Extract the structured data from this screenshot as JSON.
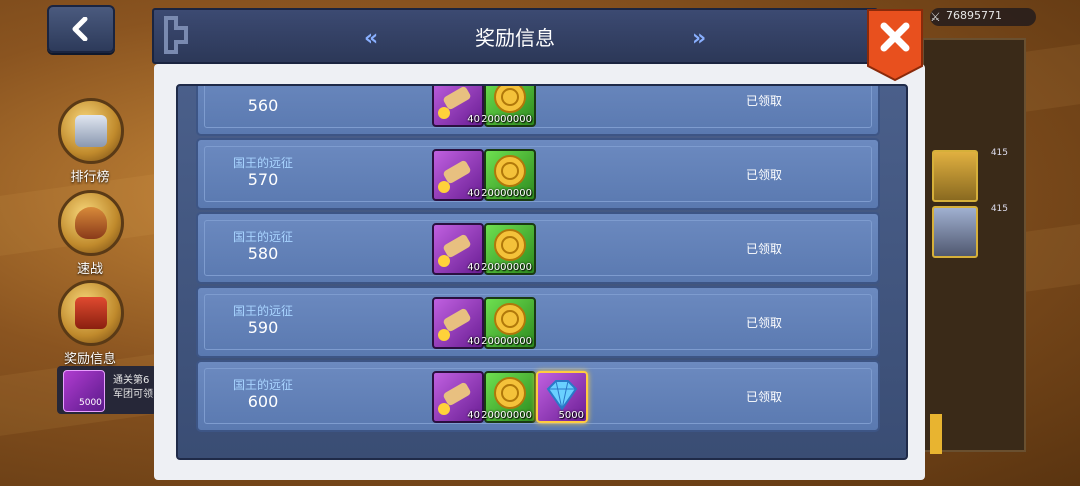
{
  "header": {
    "title": "奖励信息",
    "close_label": "✖"
  },
  "currency": {
    "value": "76895771"
  },
  "sidebar": {
    "items": [
      {
        "label": "排行榜",
        "icon": "trophy-icon"
      },
      {
        "label": "速战",
        "icon": "shield-icon"
      },
      {
        "label": "奖励信息",
        "icon": "chest-icon"
      }
    ],
    "notice": {
      "line1": "通关第6",
      "line2": "军团可领",
      "count": "5000"
    }
  },
  "right_heroes": [
    {
      "level": "415"
    },
    {
      "level": "415"
    }
  ],
  "rewards": [
    {
      "name": "",
      "level": "560",
      "status": "已领取",
      "items": [
        {
          "type": "scroll-fragment",
          "qty": "40"
        },
        {
          "type": "gold-coin",
          "qty": "20000000"
        }
      ]
    },
    {
      "name": "国王的远征",
      "level": "570",
      "status": "已领取",
      "items": [
        {
          "type": "scroll-fragment",
          "qty": "40"
        },
        {
          "type": "gold-coin",
          "qty": "20000000"
        }
      ]
    },
    {
      "name": "国王的远征",
      "level": "580",
      "status": "已领取",
      "items": [
        {
          "type": "scroll-fragment",
          "qty": "40"
        },
        {
          "type": "gold-coin",
          "qty": "20000000"
        }
      ]
    },
    {
      "name": "国王的远征",
      "level": "590",
      "status": "已领取",
      "items": [
        {
          "type": "scroll-fragment",
          "qty": "40"
        },
        {
          "type": "gold-coin",
          "qty": "20000000"
        }
      ]
    },
    {
      "name": "国王的远征",
      "level": "600",
      "status": "已领取",
      "items": [
        {
          "type": "scroll-fragment",
          "qty": "40"
        },
        {
          "type": "gold-coin",
          "qty": "20000000"
        },
        {
          "type": "diamond",
          "qty": "5000"
        }
      ]
    }
  ],
  "colors": {
    "accent": "#e8501e",
    "panel": "#4a5f8a",
    "row": "#6c8ac0"
  }
}
